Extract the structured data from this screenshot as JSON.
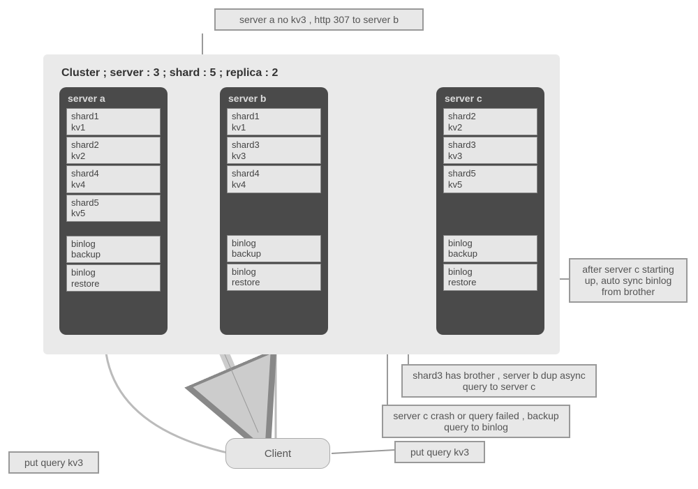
{
  "cluster": {
    "title": "Cluster ; server : 3 ; shard : 5 ; replica : 2"
  },
  "servers": {
    "a": {
      "label": "server a",
      "shards": [
        "shard1\nkv1",
        "shard2\nkv2",
        "shard4\nkv4",
        "shard5\nkv5"
      ],
      "binlog": [
        "binlog\nbackup",
        "binlog\nrestore"
      ]
    },
    "b": {
      "label": "server b",
      "shards": [
        "shard1\nkv1",
        "shard3\nkv3",
        "shard4\nkv4"
      ],
      "binlog": [
        "binlog\nbackup",
        "binlog\nrestore"
      ]
    },
    "c": {
      "label": "server c",
      "shards": [
        "shard2\nkv2",
        "shard3\nkv3",
        "shard5\nkv5"
      ],
      "binlog": [
        "binlog\nbackup",
        "binlog\nrestore"
      ]
    }
  },
  "notes": {
    "top": "server a no kv3 , http 307 to server b",
    "right_top": "after server c starting up, auto sync binlog from brother",
    "right_mid": "shard3 has brother , server b dup async query to server c",
    "right_bot": "server c crash or query failed , backup query to binlog",
    "left_bot": "put query kv3",
    "right_bot2": "put query kv3"
  },
  "client": {
    "label": "Client"
  }
}
